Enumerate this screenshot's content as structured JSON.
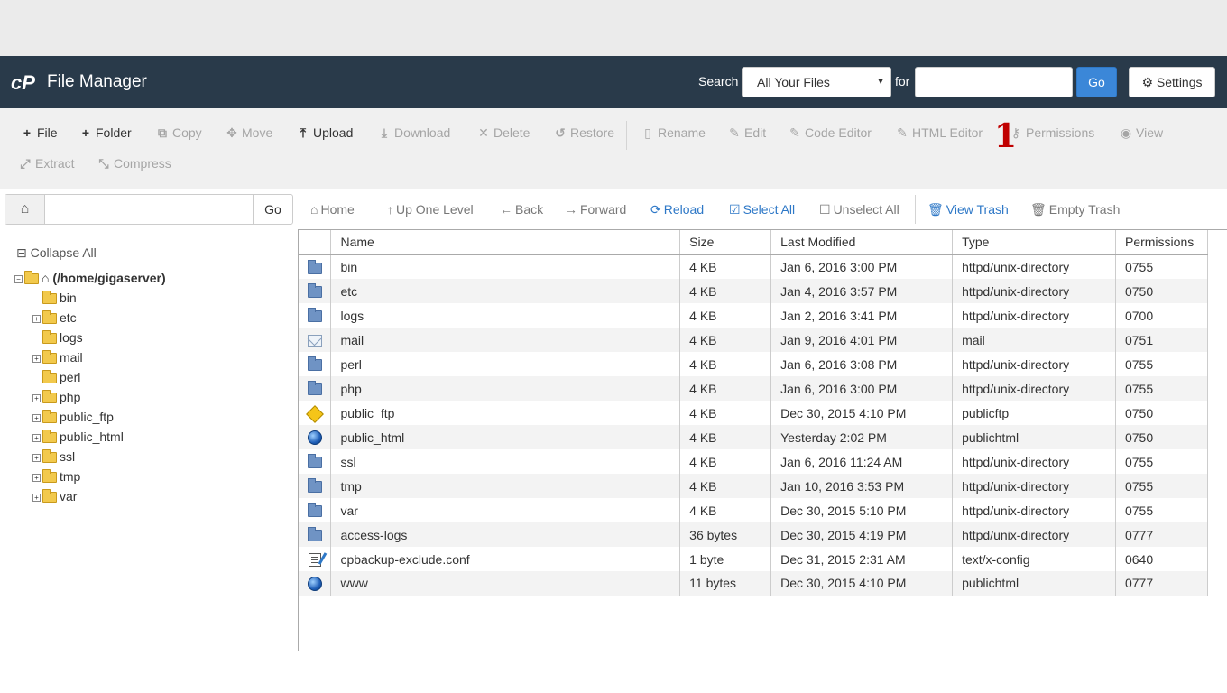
{
  "header": {
    "app_title": "File Manager",
    "search_label": "Search",
    "search_scope": "All Your Files",
    "for_label": "for",
    "search_value": "",
    "go_label": "Go",
    "settings_label": "Settings"
  },
  "toolbar": {
    "file": "File",
    "folder": "Folder",
    "copy": "Copy",
    "move": "Move",
    "upload": "Upload",
    "download": "Download",
    "delete": "Delete",
    "restore": "Restore",
    "rename": "Rename",
    "edit": "Edit",
    "code_editor": "Code Editor",
    "html_editor": "HTML Editor",
    "permissions": "Permissions",
    "view": "View",
    "extract": "Extract",
    "compress": "Compress",
    "step_marker": "1"
  },
  "sidebar": {
    "path_value": "",
    "go_label": "Go",
    "collapse_all": "Collapse All",
    "root": "(/home/gigaserver)",
    "items": [
      {
        "label": "bin",
        "expandable": false
      },
      {
        "label": "etc",
        "expandable": true
      },
      {
        "label": "logs",
        "expandable": false
      },
      {
        "label": "mail",
        "expandable": true
      },
      {
        "label": "perl",
        "expandable": false
      },
      {
        "label": "php",
        "expandable": true
      },
      {
        "label": "public_ftp",
        "expandable": true
      },
      {
        "label": "public_html",
        "expandable": true
      },
      {
        "label": "ssl",
        "expandable": true
      },
      {
        "label": "tmp",
        "expandable": true
      },
      {
        "label": "var",
        "expandable": true
      }
    ]
  },
  "nav": {
    "home": "Home",
    "up_one_level": "Up One Level",
    "back": "Back",
    "forward": "Forward",
    "reload": "Reload",
    "select_all": "Select All",
    "unselect_all": "Unselect All",
    "view_trash": "View Trash",
    "empty_trash": "Empty Trash"
  },
  "table": {
    "columns": [
      "Name",
      "Size",
      "Last Modified",
      "Type",
      "Permissions"
    ],
    "rows": [
      {
        "icon": "folder-icon",
        "name": "bin",
        "size": "4 KB",
        "modified": "Jan 6, 2016 3:00 PM",
        "type": "httpd/unix-directory",
        "perms": "0755"
      },
      {
        "icon": "folder-icon",
        "name": "etc",
        "size": "4 KB",
        "modified": "Jan 4, 2016 3:57 PM",
        "type": "httpd/unix-directory",
        "perms": "0750"
      },
      {
        "icon": "folder-icon",
        "name": "logs",
        "size": "4 KB",
        "modified": "Jan 2, 2016 3:41 PM",
        "type": "httpd/unix-directory",
        "perms": "0700"
      },
      {
        "icon": "mail-icon",
        "name": "mail",
        "size": "4 KB",
        "modified": "Jan 9, 2016 4:01 PM",
        "type": "mail",
        "perms": "0751"
      },
      {
        "icon": "folder-icon",
        "name": "perl",
        "size": "4 KB",
        "modified": "Jan 6, 2016 3:08 PM",
        "type": "httpd/unix-directory",
        "perms": "0755"
      },
      {
        "icon": "folder-icon",
        "name": "php",
        "size": "4 KB",
        "modified": "Jan 6, 2016 3:00 PM",
        "type": "httpd/unix-directory",
        "perms": "0755"
      },
      {
        "icon": "ftp-icon",
        "name": "public_ftp",
        "size": "4 KB",
        "modified": "Dec 30, 2015 4:10 PM",
        "type": "publicftp",
        "perms": "0750"
      },
      {
        "icon": "globe-icon",
        "name": "public_html",
        "size": "4 KB",
        "modified": "Yesterday 2:02 PM",
        "type": "publichtml",
        "perms": "0750"
      },
      {
        "icon": "folder-icon",
        "name": "ssl",
        "size": "4 KB",
        "modified": "Jan 6, 2016 11:24 AM",
        "type": "httpd/unix-directory",
        "perms": "0755"
      },
      {
        "icon": "folder-icon",
        "name": "tmp",
        "size": "4 KB",
        "modified": "Jan 10, 2016 3:53 PM",
        "type": "httpd/unix-directory",
        "perms": "0755"
      },
      {
        "icon": "folder-icon",
        "name": "var",
        "size": "4 KB",
        "modified": "Dec 30, 2015 5:10 PM",
        "type": "httpd/unix-directory",
        "perms": "0755"
      },
      {
        "icon": "folder-icon",
        "name": "access-logs",
        "size": "36 bytes",
        "modified": "Dec 30, 2015 4:19 PM",
        "type": "httpd/unix-directory",
        "perms": "0777"
      },
      {
        "icon": "config-file-icon",
        "name": "cpbackup-exclude.conf",
        "size": "1 byte",
        "modified": "Dec 31, 2015 2:31 AM",
        "type": "text/x-config",
        "perms": "0640"
      },
      {
        "icon": "globe-icon",
        "name": "www",
        "size": "11 bytes",
        "modified": "Dec 30, 2015 4:10 PM",
        "type": "publichtml",
        "perms": "0777"
      }
    ]
  },
  "colors": {
    "header_bg": "#293a4a",
    "accent_blue": "#3b87d8",
    "marker_red": "#c00000"
  }
}
